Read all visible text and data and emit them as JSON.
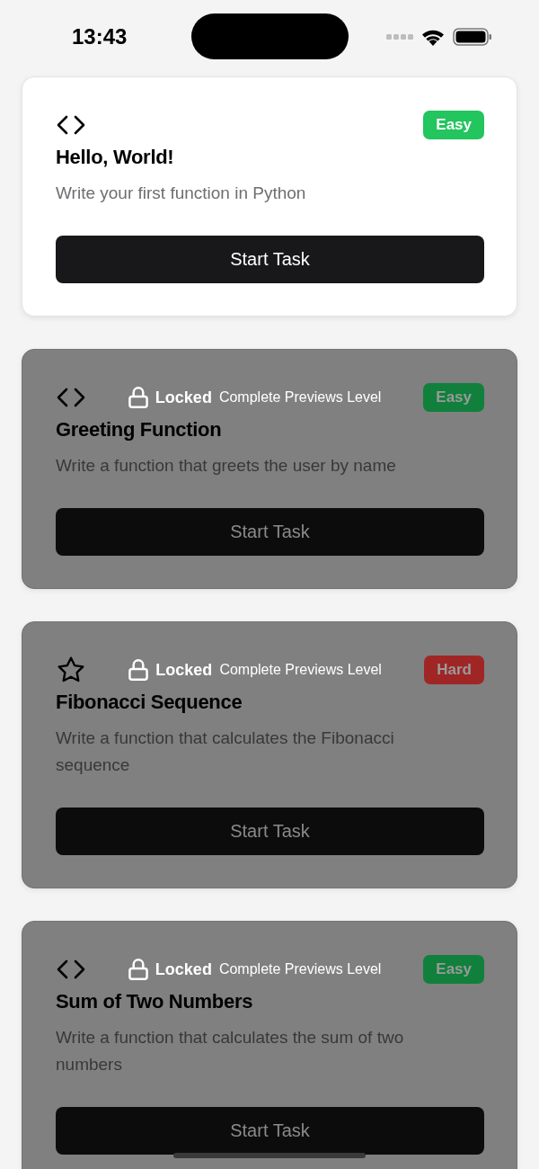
{
  "status_bar": {
    "time": "13:43"
  },
  "tasks": [
    {
      "kind": "code",
      "title": "Hello, World!",
      "description": "Write your first function in Python",
      "difficulty": "Easy",
      "color": "#22c55e",
      "button": "Start Task",
      "locked": false
    },
    {
      "kind": "code",
      "title": "Greeting Function",
      "description": "Write a function that greets the user by name",
      "difficulty": "Easy",
      "color": "#11803c",
      "button": "Start Task",
      "locked": true,
      "lock_title": "Locked",
      "lock_message": "Complete Previews Level"
    },
    {
      "kind": "star",
      "title": "Fibonacci Sequence",
      "description": "Write a function that calculates the Fibonacci sequence",
      "difficulty": "Hard",
      "color": "#a02626",
      "button": "Start Task",
      "locked": true,
      "lock_title": "Locked",
      "lock_message": "Complete Previews Level"
    },
    {
      "kind": "code",
      "title": "Sum of Two Numbers",
      "description": "Write a function that calculates the sum of two numbers",
      "difficulty": "Easy",
      "color": "#11803c",
      "button": "Start Task",
      "locked": true,
      "lock_title": "Locked",
      "lock_message": "Complete Previews Level"
    }
  ]
}
